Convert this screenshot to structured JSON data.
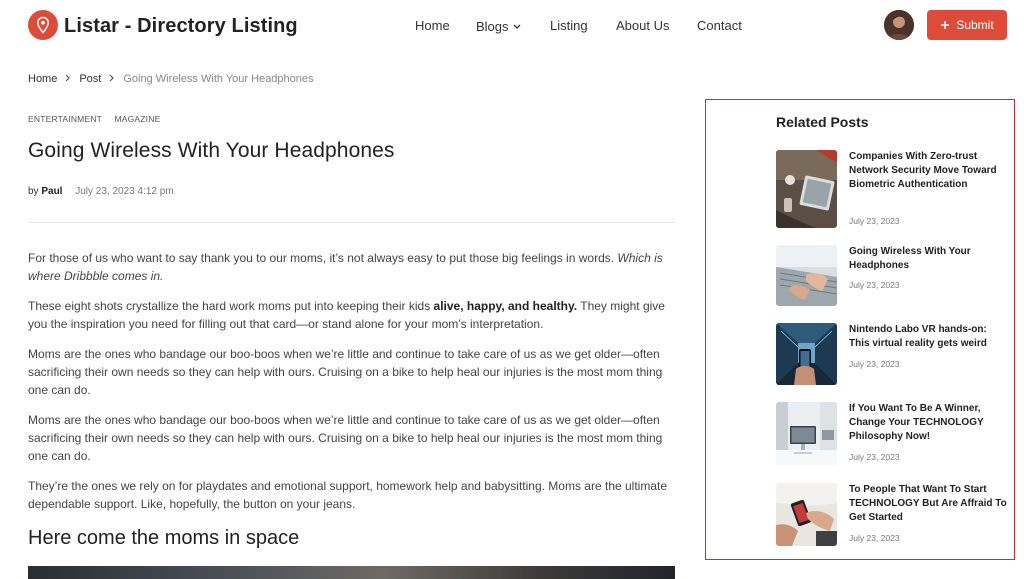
{
  "header": {
    "site_title": "Listar - Directory Listing",
    "nav": [
      {
        "label": "Home"
      },
      {
        "label": "Blogs"
      },
      {
        "label": "Listing"
      },
      {
        "label": "About Us"
      },
      {
        "label": "Contact"
      }
    ],
    "submit_label": "Submit"
  },
  "breadcrumb": {
    "home": "Home",
    "post": "Post",
    "current": "Going Wireless With Your Headphones"
  },
  "article": {
    "tags": [
      "ENTERTAINMENT",
      "MAGAZINE"
    ],
    "title": "Going Wireless With Your Headphones",
    "by": "by",
    "author": "Paul",
    "date": "July 23, 2023 4:12 pm",
    "p1_text": "For those of us who want to say thank you to our moms, it’s not always easy to put those big feelings in words. ",
    "p1_em": "Which is where Dribbble comes in.",
    "p2_text": "These eight shots crystallize the hard work moms put into keeping their kids ",
    "p2_strong": "alive, happy, and healthy.",
    "p2_rest": " They might give you the inspiration you need for filling out that card—or stand alone for your mom’s interpretation.",
    "p3": "Moms are the ones who bandage our boo-boos when we’re little and continue to take care of us as we get older—often sacrificing their own needs so they can help with ours. Cruising on a bike to help heal our injuries is the most mom thing one can do.",
    "p4": "Moms are the ones who bandage our boo-boos when we’re little and continue to take care of us as we get older—often sacrificing their own needs so they can help with ours. Cruising on a bike to help heal our injuries is the most mom thing one can do.",
    "p5": "They’re the ones we rely on for playdates and emotional support, homework help and babysitting. Moms are the ultimate dependable support. Like, hopefully, the button on your jeans.",
    "subheading": "Here come the moms in space"
  },
  "sidebar": {
    "title": "Related Posts",
    "posts": [
      {
        "title": "Companies With Zero-trust Network Security Move Toward Biometric Authentication",
        "date": "July 23, 2023"
      },
      {
        "title": "Going Wireless With Your Headphones",
        "date": "July 23, 2023"
      },
      {
        "title": "Nintendo Labo VR hands-on: This virtual reality gets weird",
        "date": "July 23, 2023"
      },
      {
        "title": "If You Want To Be A Winner, Change Your TECHNOLOGY Philosophy Now!",
        "date": "July 23, 2023"
      },
      {
        "title": "To People That Want To Start TECHNOLOGY But Are Affraid To Get Started",
        "date": "July 23, 2023"
      }
    ]
  },
  "colors": {
    "brand": "#dd4b39",
    "highlight_border": "#cc2b3a"
  },
  "icons": [
    "location-pin-icon",
    "chevron-down-icon",
    "plus-icon",
    "chevron-right-icon"
  ]
}
